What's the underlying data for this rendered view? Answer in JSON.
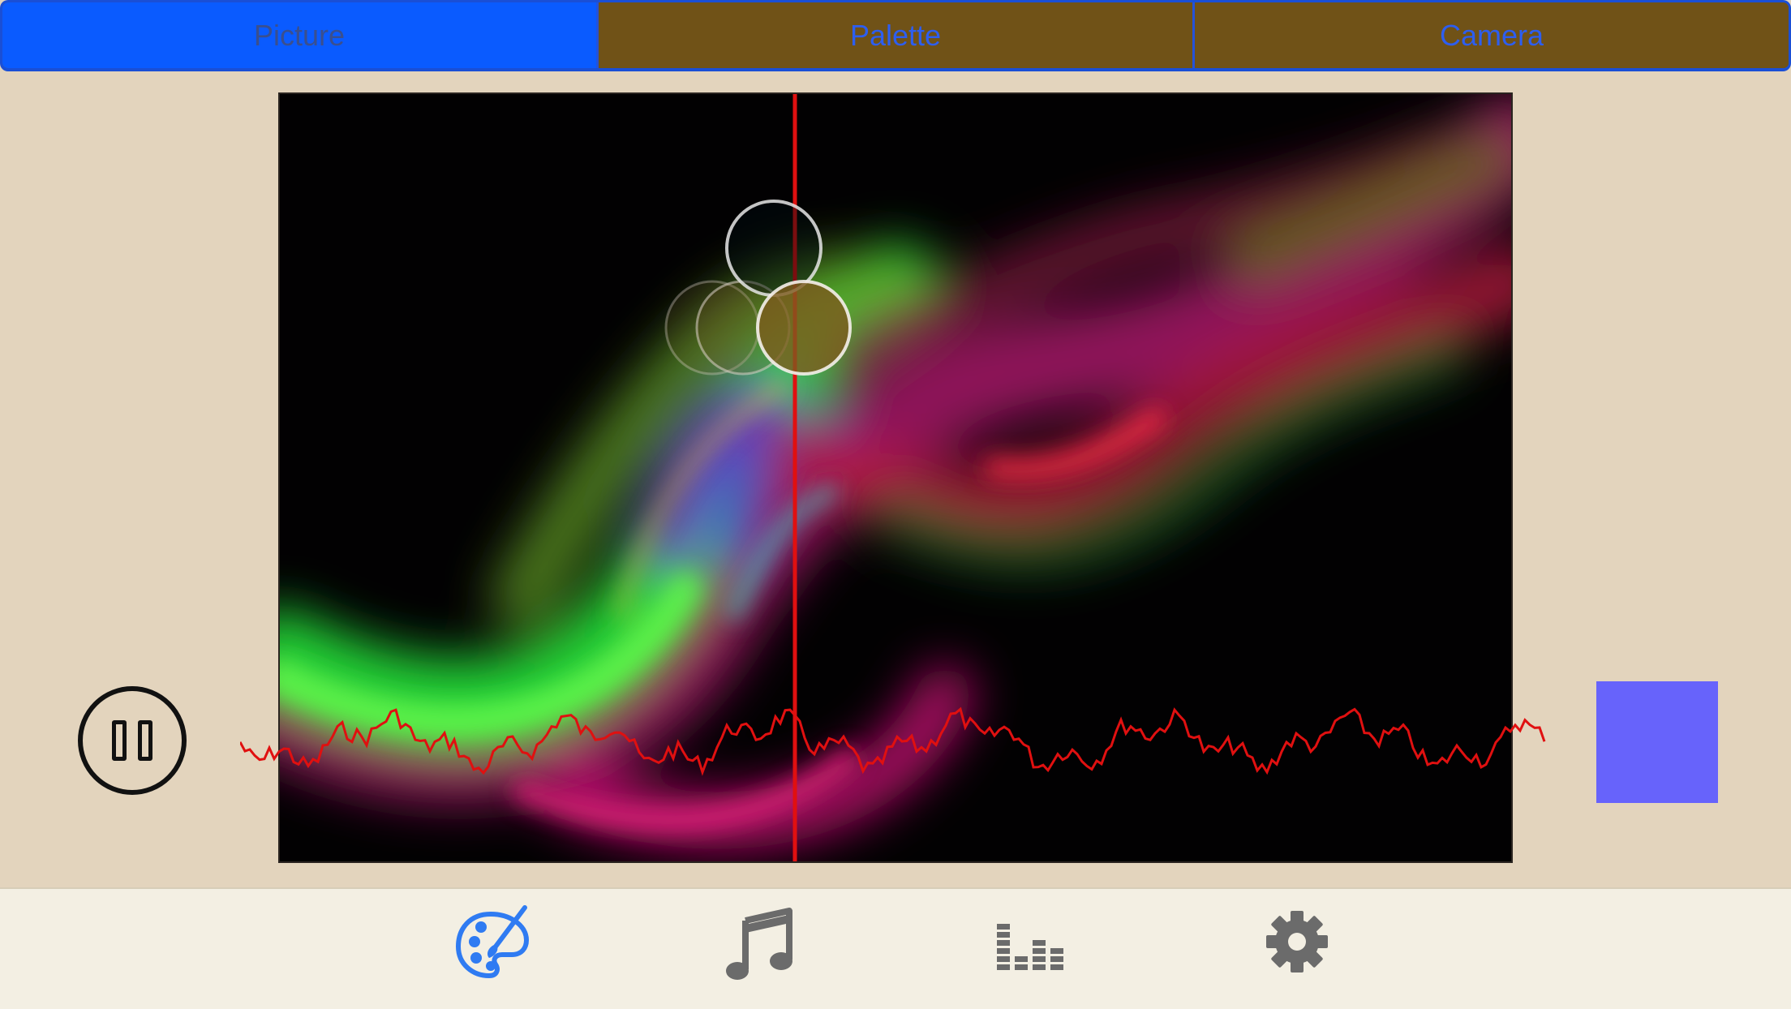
{
  "segments": {
    "picture_label": "Picture",
    "palette_label": "Palette",
    "camera_label": "Camera",
    "selected": "Picture"
  },
  "colors": {
    "segment_active_bg": "#0a5bff",
    "segment_bg": "#705217",
    "segment_text": "#2d5ef0",
    "playhead": "#e01010",
    "waveform": "#e01010",
    "swatch": "#6763fb",
    "tab_active": "#2f7bf2",
    "tab_inactive": "#6b6b6b",
    "background": "#e3d4bd"
  },
  "tabbar": {
    "items": [
      {
        "name": "palette-brush-icon",
        "active": true
      },
      {
        "name": "music-note-icon",
        "active": false
      },
      {
        "name": "equalizer-icon",
        "active": false
      },
      {
        "name": "gear-icon",
        "active": false
      }
    ]
  }
}
